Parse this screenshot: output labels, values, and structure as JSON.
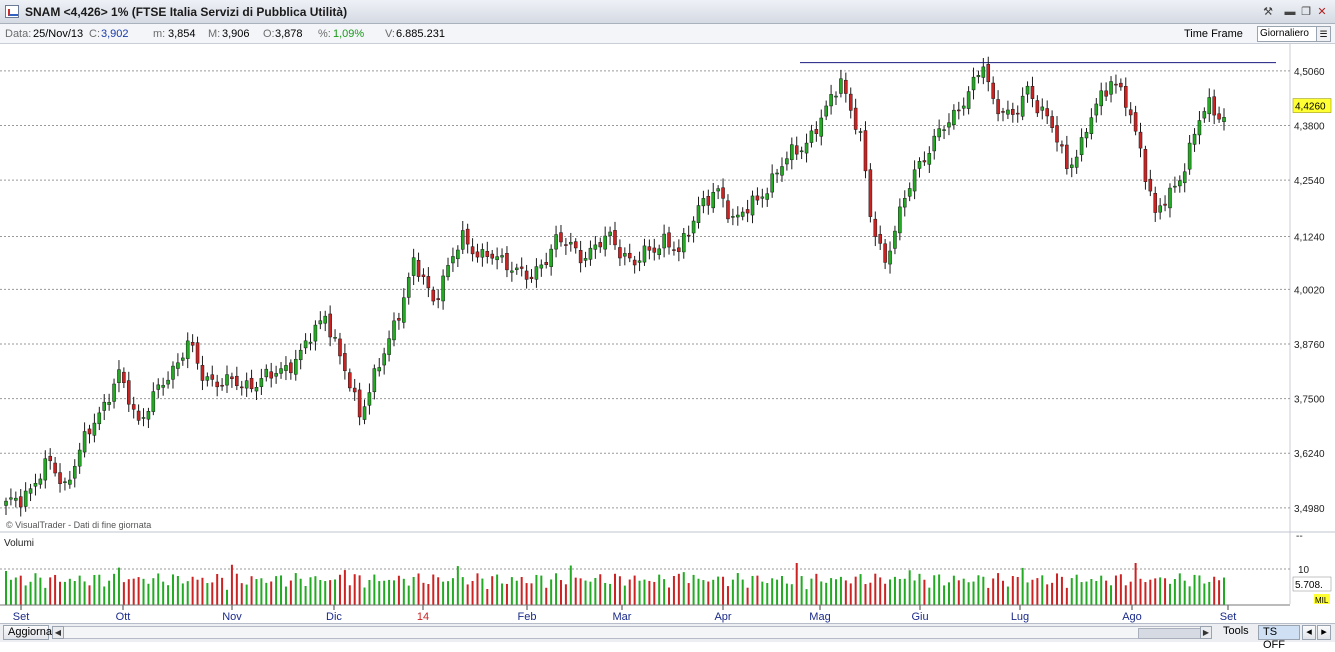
{
  "window": {
    "title": "SNAM <4,426> 1%  (FTSE Italia Servizi di Pubblica Utilità)"
  },
  "info": {
    "date_label": "Data:",
    "date_value": "25/Nov/13",
    "close_label": "C:",
    "close_value": "3,902",
    "min_label": "m:",
    "min_value": "3,854",
    "max_label": "M:",
    "max_value": "3,906",
    "open_label": "O:",
    "open_value": "3,878",
    "pct_label": "%:",
    "pct_value": "1,09%",
    "vol_label": "V:",
    "vol_value": "6.885.231",
    "timeframe_label": "Time Frame",
    "timeframe_value": "Giornaliero"
  },
  "colors": {
    "up": "#22aa22",
    "down": "#cc2222",
    "last_price_bg": "#ffff33",
    "trendline": "#1a1a80"
  },
  "chart_data": {
    "type": "candlestick",
    "price_axis_ticks": [
      "4,5060",
      "4,3800",
      "4,2540",
      "4,1240",
      "4,0020",
      "3,8760",
      "3,7500",
      "3,6240",
      "3,4980"
    ],
    "price_axis_range": [
      3.47,
      4.545
    ],
    "last_price_label": "4,4260",
    "x_tick_labels": [
      "Set",
      "Ott",
      "Nov",
      "Dic",
      "14",
      "Feb",
      "Mar",
      "Apr",
      "Mag",
      "Giu",
      "Lug",
      "Ago",
      "Set"
    ],
    "resistance_line": 4.525,
    "watermark": "© VisualTrader - Dati di fine giornata",
    "anchors": [
      [
        0,
        3.5
      ],
      [
        3,
        3.52
      ],
      [
        9,
        3.6
      ],
      [
        12,
        3.55
      ],
      [
        18,
        3.7
      ],
      [
        23,
        3.8
      ],
      [
        27,
        3.7
      ],
      [
        33,
        3.8
      ],
      [
        37,
        3.88
      ],
      [
        40,
        3.8
      ],
      [
        48,
        3.78
      ],
      [
        54,
        3.8
      ],
      [
        60,
        3.85
      ],
      [
        65,
        3.95
      ],
      [
        68,
        3.84
      ],
      [
        72,
        3.72
      ],
      [
        77,
        3.85
      ],
      [
        83,
        4.06
      ],
      [
        87,
        3.98
      ],
      [
        93,
        4.12
      ],
      [
        97,
        4.08
      ],
      [
        103,
        4.06
      ],
      [
        107,
        4.02
      ],
      [
        112,
        4.12
      ],
      [
        117,
        4.08
      ],
      [
        123,
        4.12
      ],
      [
        128,
        4.06
      ],
      [
        134,
        4.12
      ],
      [
        137,
        4.08
      ],
      [
        141,
        4.2
      ],
      [
        145,
        4.22
      ],
      [
        148,
        4.17
      ],
      [
        153,
        4.2
      ],
      [
        157,
        4.28
      ],
      [
        162,
        4.33
      ],
      [
        167,
        4.41
      ],
      [
        170,
        4.49
      ],
      [
        174,
        4.35
      ],
      [
        176,
        4.17
      ],
      [
        179,
        4.07
      ],
      [
        182,
        4.17
      ],
      [
        185,
        4.28
      ],
      [
        189,
        4.34
      ],
      [
        193,
        4.41
      ],
      [
        197,
        4.47
      ],
      [
        199,
        4.52
      ],
      [
        201,
        4.44
      ],
      [
        205,
        4.39
      ],
      [
        208,
        4.47
      ],
      [
        211,
        4.41
      ],
      [
        214,
        4.35
      ],
      [
        216,
        4.29
      ],
      [
        219,
        4.33
      ],
      [
        222,
        4.43
      ],
      [
        225,
        4.49
      ],
      [
        228,
        4.43
      ],
      [
        231,
        4.33
      ],
      [
        234,
        4.17
      ],
      [
        237,
        4.22
      ],
      [
        240,
        4.29
      ],
      [
        243,
        4.39
      ],
      [
        245,
        4.43
      ],
      [
        248,
        4.4
      ]
    ],
    "volume_label": "Volumi",
    "volume_ticks": [
      "--",
      "10"
    ],
    "volume_last": "5.708.",
    "volume_unit": "MIL"
  },
  "status": {
    "refresh_label": "Aggiorna",
    "tools_label": "Tools",
    "ts_label": "TS OFF"
  }
}
